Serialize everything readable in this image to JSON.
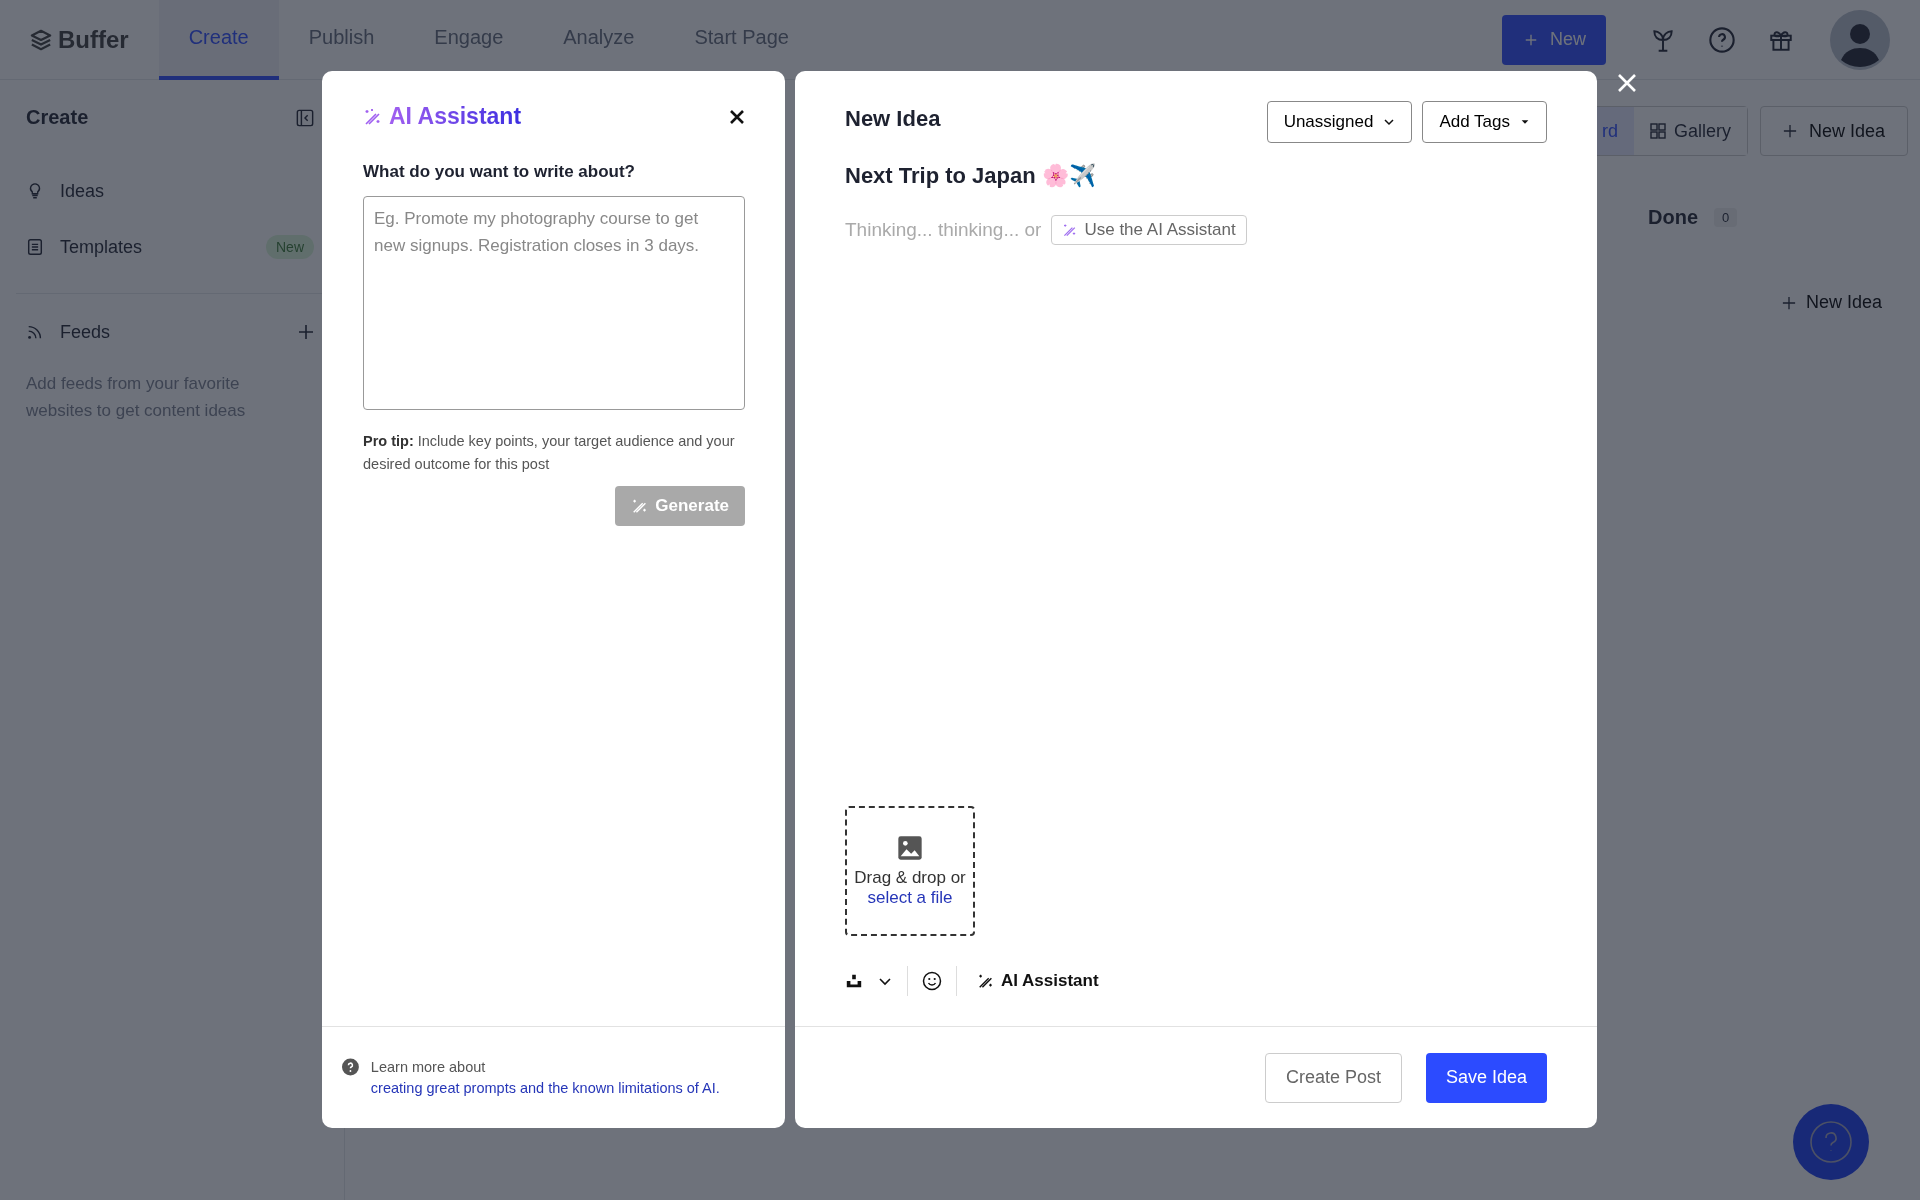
{
  "topbar": {
    "logo": "Buffer",
    "tabs": [
      {
        "label": "Create",
        "selected": true
      },
      {
        "label": "Publish",
        "selected": false
      },
      {
        "label": "Engage",
        "selected": false
      },
      {
        "label": "Analyze",
        "selected": false
      },
      {
        "label": "Start Page",
        "selected": false
      }
    ],
    "new_button": "New"
  },
  "sidebar": {
    "title": "Create",
    "items": [
      {
        "label": "Ideas",
        "kind": "ideas"
      },
      {
        "label": "Templates",
        "kind": "templates",
        "badge": "New"
      }
    ],
    "feeds": {
      "label": "Feeds",
      "hint": "Add feeds from your favorite websites to get content ideas"
    }
  },
  "board": {
    "view_tabs": [
      {
        "label": "rd",
        "selected": true
      },
      {
        "label": "Gallery",
        "selected": false
      }
    ],
    "new_idea_button": "New Idea",
    "column": {
      "title": "Done",
      "count": "0",
      "add_label": "New Idea"
    }
  },
  "ai_panel": {
    "title": "AI Assistant",
    "prompt_label": "What do you want to write about?",
    "placeholder": "Eg. Promote my photography course to get new signups. Registration closes in 3 days.",
    "tip": "**Pro tip:** Include key points, your target audience and your desired outcome for this post",
    "generate_button": {
      "label": "Generate",
      "disabled": true
    },
    "footer": {
      "text": "Learn more about",
      "link": "creating great prompts and the known limitations of AI."
    }
  },
  "idea_panel": {
    "title": "New Idea",
    "assignee": "Unassigned",
    "tags_button": "Add Tags",
    "idea_title": "Next Trip to Japan 🌸✈️",
    "body_placeholder": "Thinking... thinking... or",
    "ai_link": "Use the AI Assistant",
    "upload": {
      "text": "Drag & drop or",
      "link": "select a file"
    },
    "toolbar_ai": "AI Assistant",
    "buttons": [
      {
        "label": "Create Post",
        "kind": "secondary"
      },
      {
        "label": "Save Idea",
        "kind": "primary"
      }
    ]
  }
}
